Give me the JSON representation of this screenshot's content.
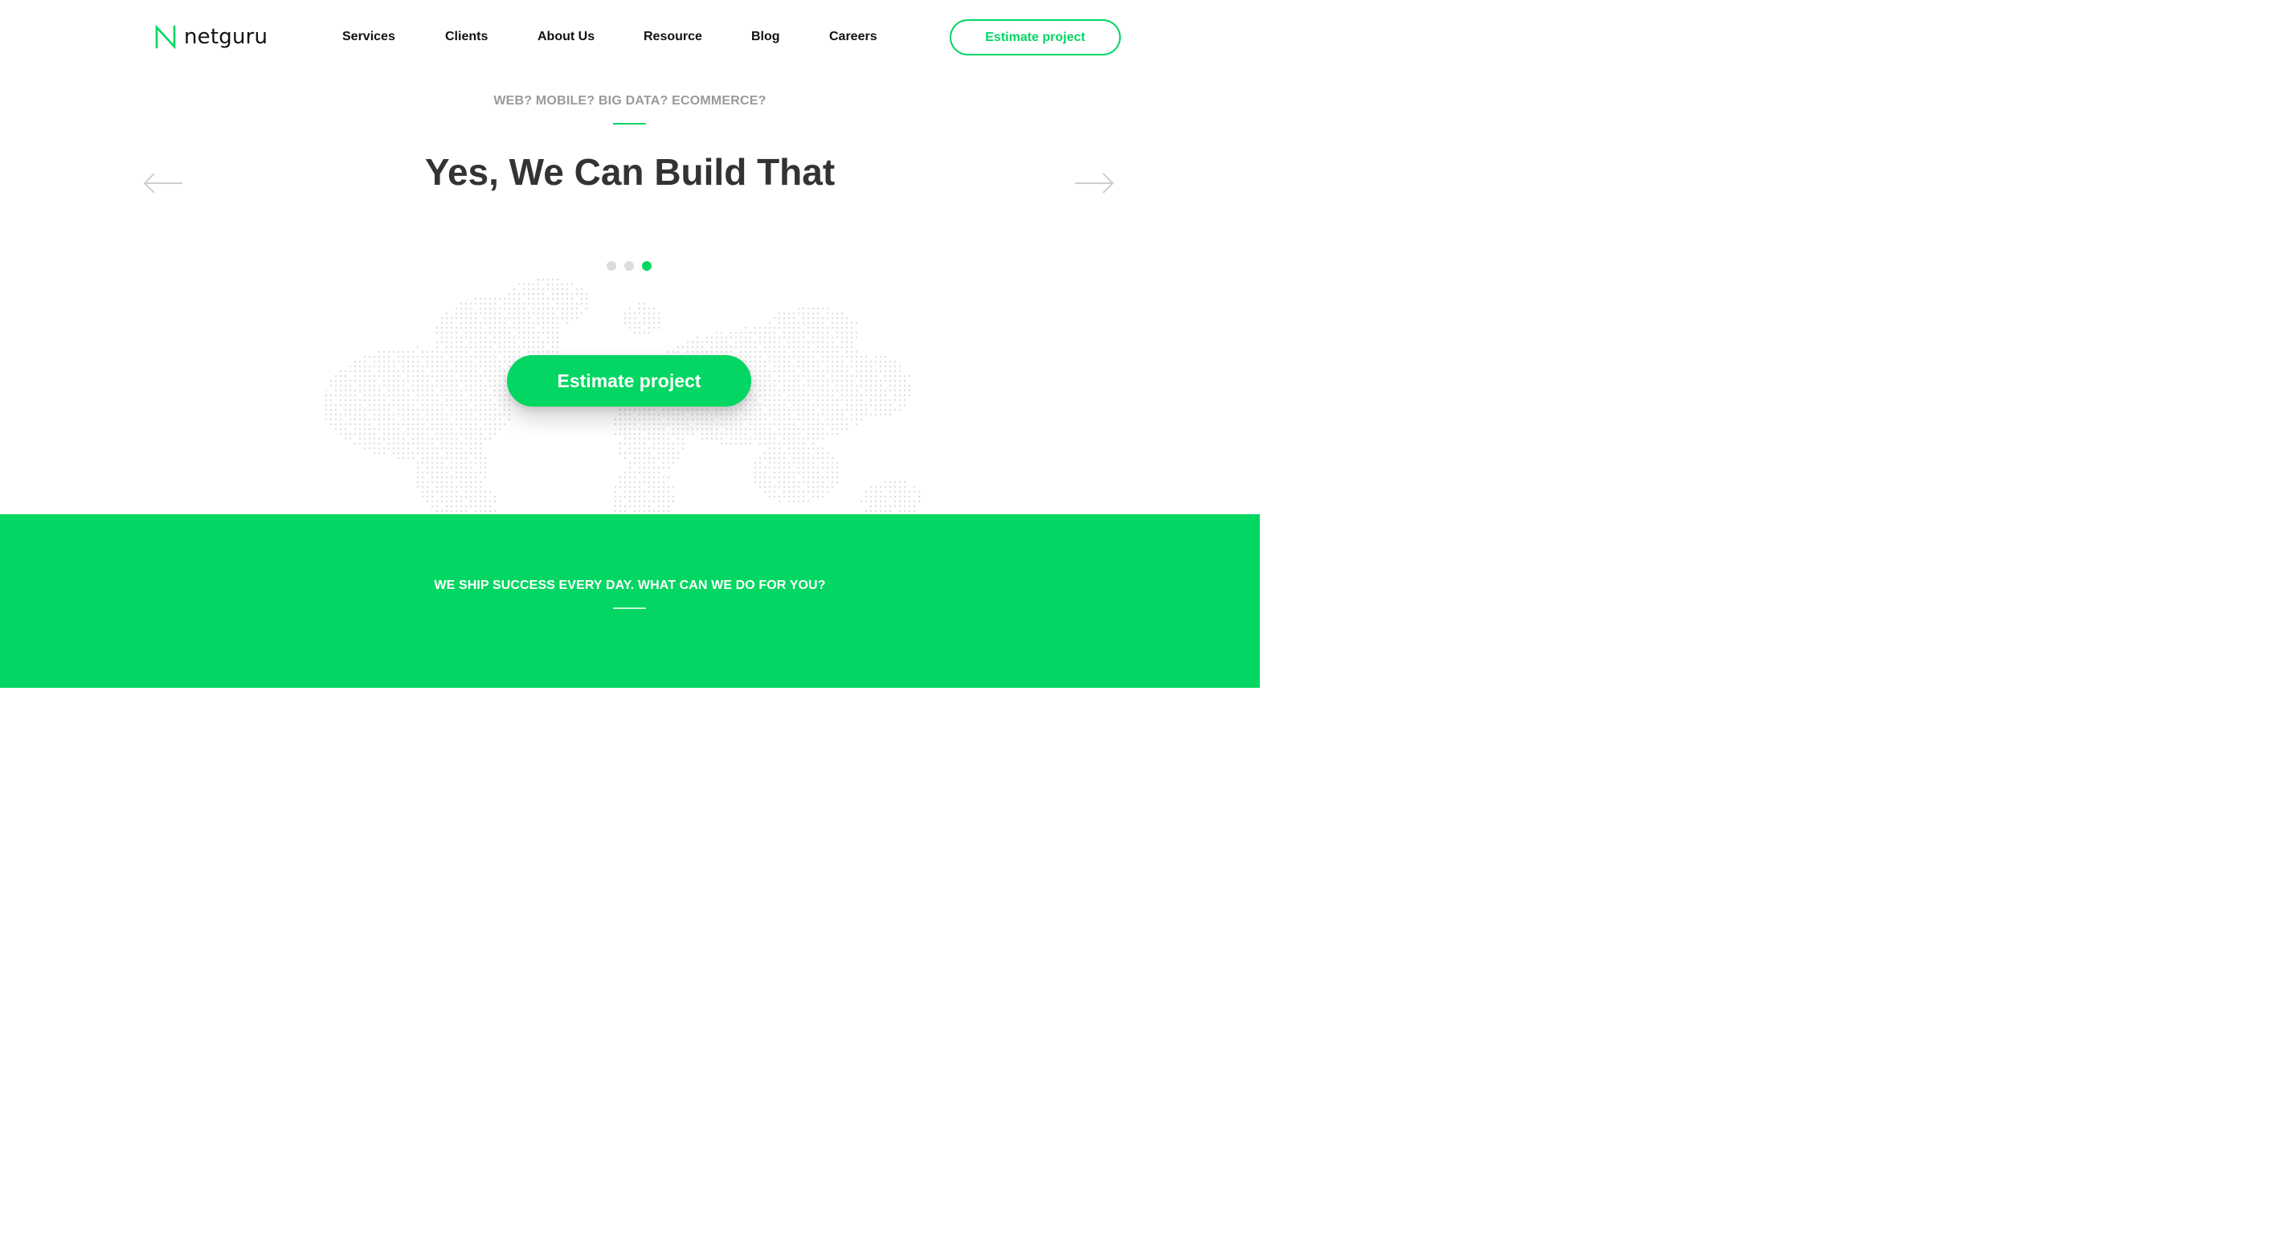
{
  "brand": {
    "name": "netguru",
    "logo_icon": "netguru-n-logo-icon",
    "accent_color": "#03d662"
  },
  "nav": {
    "items": [
      {
        "label": "Services"
      },
      {
        "label": "Clients"
      },
      {
        "label": "About Us"
      },
      {
        "label": "Resource"
      },
      {
        "label": "Blog"
      },
      {
        "label": "Careers"
      }
    ],
    "cta_label": "Estimate project"
  },
  "hero": {
    "eyebrow": "WEB? MOBILE? BIG DATA? ECOMMERCE?",
    "title": "Yes, We Can Build That",
    "prev_icon": "arrow-left-icon",
    "next_icon": "arrow-right-icon",
    "slider": {
      "total_slides": 3,
      "active_slide": 3
    },
    "cta_label": "Estimate project",
    "background_icon": "dotted-world-map"
  },
  "band": {
    "text": "WE SHIP SUCCESS EVERY DAY. WHAT CAN WE DO FOR YOU?",
    "background_color": "#03d662"
  }
}
